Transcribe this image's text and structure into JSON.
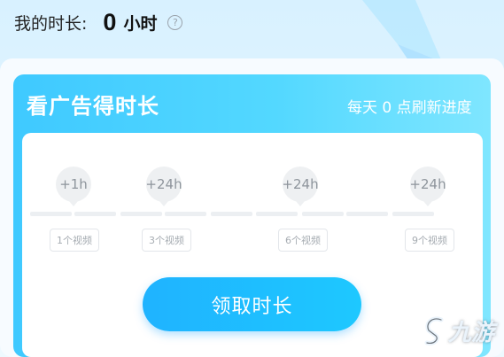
{
  "header": {
    "label": "我的时长:",
    "value": "0",
    "unit": "小时",
    "help_icon": "question-circle-icon"
  },
  "card": {
    "title": "看广告得时长",
    "subtitle": "每天 0 点刷新进度",
    "milestones": [
      {
        "reward": "+1h",
        "videos": "1个视频"
      },
      {
        "reward": "+24h",
        "videos": "3个视频"
      },
      {
        "reward": "+24h",
        "videos": "6个视频"
      },
      {
        "reward": "+24h",
        "videos": "9个视频"
      }
    ],
    "claim_button": "领取时长"
  },
  "watermark": {
    "text": "九游"
  },
  "colors": {
    "accent": "#1ec8ff",
    "card_top": "#3fc9ff"
  }
}
